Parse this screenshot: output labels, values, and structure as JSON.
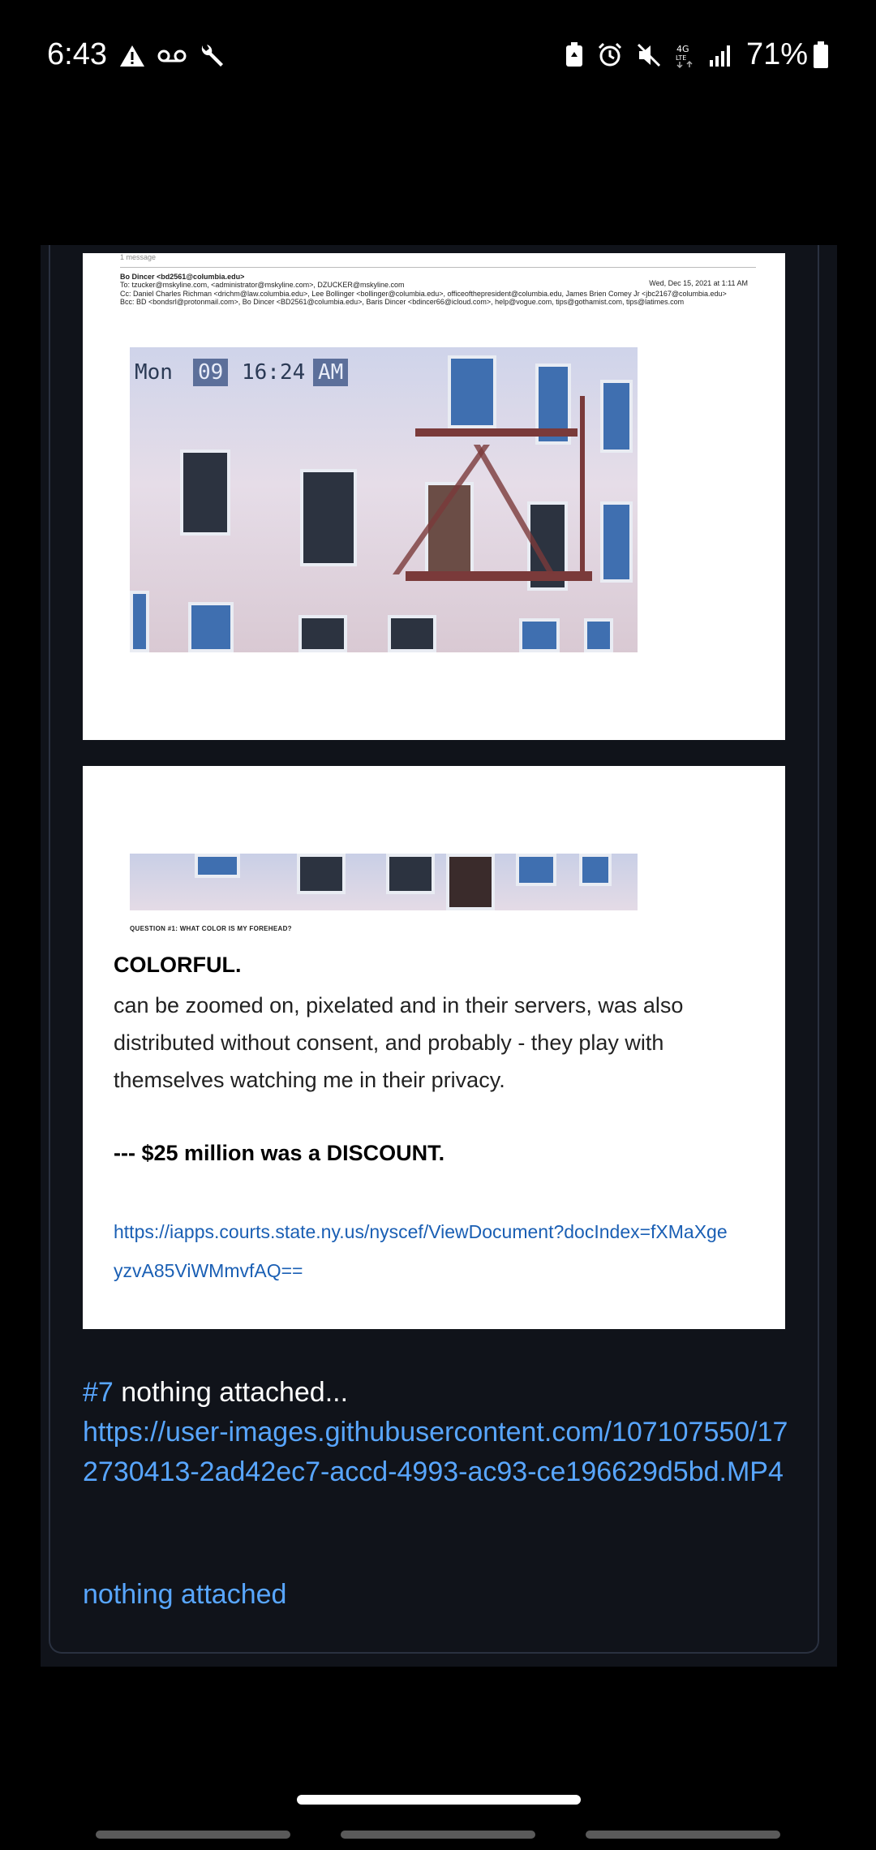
{
  "status_bar": {
    "time": "6:43",
    "battery_percent": "71%",
    "left_icons": [
      "warning-icon",
      "voicemail-icon",
      "wrench-icon"
    ],
    "right_icons": [
      "battery-saver-icon",
      "alarm-icon",
      "mute-icon",
      "4g-lte-icon",
      "signal-icon",
      "battery-icon"
    ]
  },
  "email": {
    "message_count": "1 message",
    "from": "Bo Dincer <bd2561@columbia.edu>",
    "to": "To: tzucker@mskyline.com, <administrator@mskyline.com>, DZUCKER@mskyline.com",
    "cc": "Cc: Daniel Charles Richman <drichm@law.columbia.edu>, Lee Bollinger <bollinger@columbia.edu>, officeofthepresident@columbia.edu, James Brien Comey Jr <jbc2167@columbia.edu>",
    "bcc": "Bcc: BD <bondsrl@protonmail.com>, Bo Dincer <BD2561@columbia.edu>, Baris Dincer <bdincer66@icloud.com>, help@vogue.com, tips@gothamist.com, tips@latimes.com",
    "date": "Wed, Dec 15, 2021 at 1:11 AM"
  },
  "photo_stamp": {
    "day": "Mon",
    "date": "09",
    "time": "16:24",
    "ampm": "AM"
  },
  "document": {
    "question": "QUESTION #1:   WHAT COLOR IS MY FOREHEAD?",
    "answer_heading": "COLORFUL.",
    "body": "can be zoomed on, pixelated and in their servers, was also distributed without consent, and probably - they play with themselves watching me in their privacy.",
    "discount": "--- $25 million was a DISCOUNT.",
    "link": "https://iapps.courts.state.ny.us/nyscef/ViewDocument?docIndex=fXMaXgeyzvA85ViWMmvfAQ=="
  },
  "comment": {
    "number": "#7",
    "text": " nothing attached...",
    "url": "https://user-images.githubusercontent.com/107107550/172730413-2ad42ec7-accd-4993-ac93-ce196629d5bd.MP4",
    "footer": "nothing attached"
  }
}
